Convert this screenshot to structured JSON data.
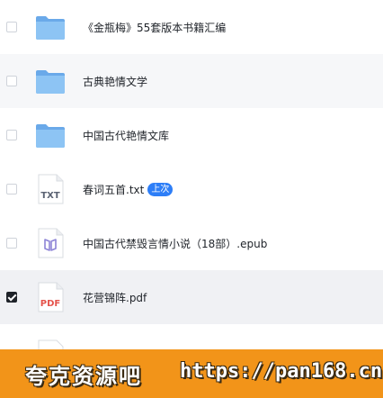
{
  "files": [
    {
      "name": "《金瓶梅》55套版本书籍汇编",
      "icon": "folder-icon",
      "checked": false
    },
    {
      "name": "古典艳情文学",
      "icon": "folder-icon",
      "checked": false
    },
    {
      "name": "中国古代艳情文库",
      "icon": "folder-icon",
      "checked": false
    },
    {
      "name": "春词五首.txt",
      "icon": "txt-file-icon",
      "type_label": "TXT",
      "badge": "上次",
      "checked": false
    },
    {
      "name": "中国古代禁毁言情小说（18部）.epub",
      "icon": "epub-file-icon",
      "checked": false
    },
    {
      "name": "花营锦阵.pdf",
      "icon": "pdf-file-icon",
      "type_label": "PDF",
      "checked": true
    }
  ],
  "banner": {
    "left_text": "夸克资源吧",
    "right_text": "https://pan168.cn"
  },
  "colors": {
    "folder": "#7fb8ee",
    "badge": "#2d7ef7",
    "pdf": "#e5534b",
    "epub": "#8d84d6",
    "banner": "#f29419"
  }
}
